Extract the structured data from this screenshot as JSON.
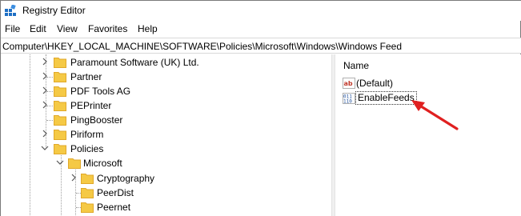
{
  "window": {
    "title": "Registry Editor",
    "icon": "registry-editor-icon"
  },
  "menu": {
    "items": [
      "File",
      "Edit",
      "View",
      "Favorites",
      "Help"
    ]
  },
  "address": {
    "path": "Computer\\HKEY_LOCAL_MACHINE\\SOFTWARE\\Policies\\Microsoft\\Windows\\Windows Feed"
  },
  "tree": {
    "items": [
      {
        "label": "Paramount Software (UK) Ltd.",
        "expander": "collapsed"
      },
      {
        "label": "Partner",
        "expander": "collapsed"
      },
      {
        "label": "PDF Tools AG",
        "expander": "collapsed"
      },
      {
        "label": "PEPrinter",
        "expander": "collapsed"
      },
      {
        "label": "PingBooster",
        "expander": "none"
      },
      {
        "label": "Piriform",
        "expander": "collapsed"
      },
      {
        "label": "Policies",
        "expander": "expanded"
      },
      {
        "label": "Microsoft",
        "expander": "expanded"
      },
      {
        "label": "Cryptography",
        "expander": "collapsed"
      },
      {
        "label": "PeerDist",
        "expander": "none"
      },
      {
        "label": "Peernet",
        "expander": "none"
      }
    ]
  },
  "list": {
    "column_name": "Name",
    "values": [
      {
        "name": "(Default)",
        "icon": "string-value-icon"
      },
      {
        "name": "EnableFeeds",
        "icon": "dword-value-icon",
        "selected": true
      }
    ]
  },
  "colors": {
    "folder": "#f5c945",
    "folder_dark": "#e0a82a",
    "annotation_arrow": "#e02020",
    "chevron": "#555555"
  }
}
